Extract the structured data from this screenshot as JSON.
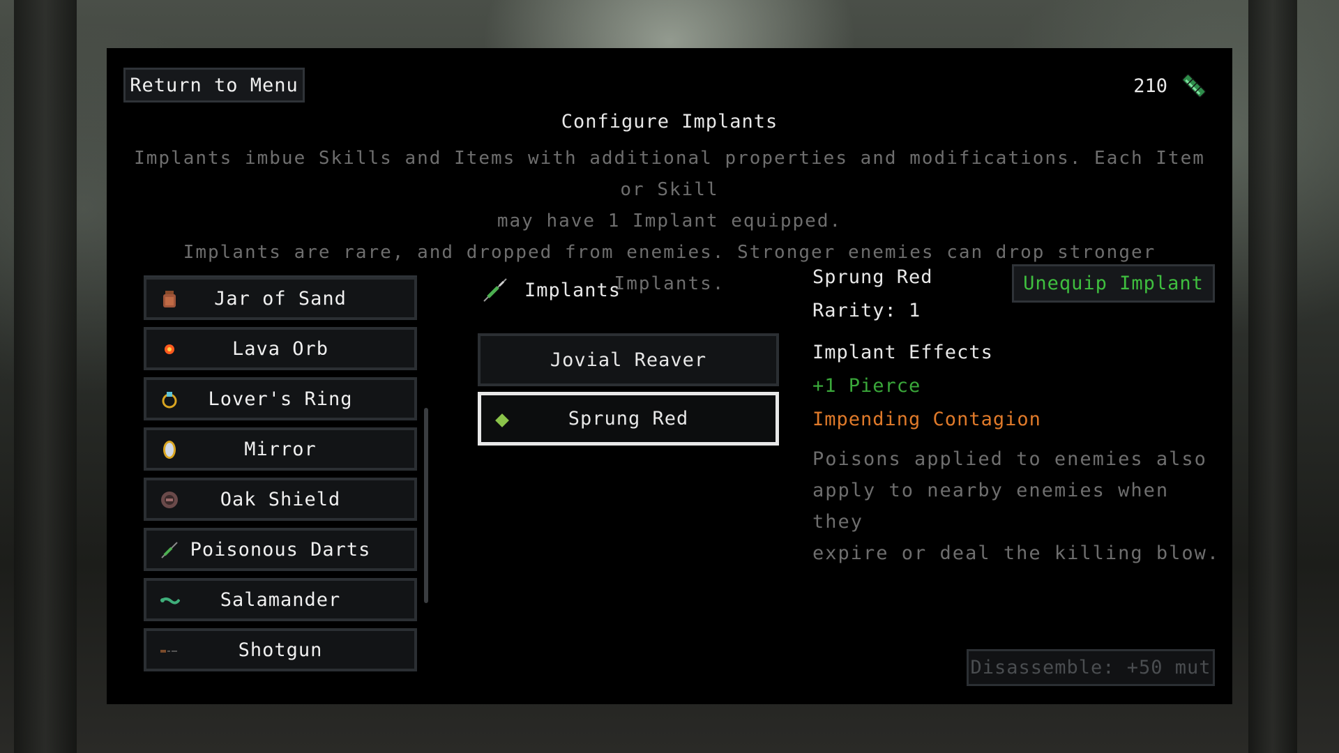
{
  "header": {
    "return_label": "Return to Menu",
    "currency_amount": "210",
    "currency_icon": "green-vial-icon",
    "title": "Configure Implants",
    "description_lines": [
      "Implants imbue Skills and Items with additional properties and modifications. Each Item or Skill",
      "may have 1 Implant equipped.",
      "Implants are rare, and dropped from enemies. Stronger enemies can drop stronger Implants."
    ]
  },
  "items": [
    {
      "label": "Jar of Sand",
      "icon": "jar-icon"
    },
    {
      "label": "Lava Orb",
      "icon": "orb-icon"
    },
    {
      "label": "Lover's Ring",
      "icon": "ring-icon"
    },
    {
      "label": "Mirror",
      "icon": "mirror-icon"
    },
    {
      "label": "Oak Shield",
      "icon": "shield-icon"
    },
    {
      "label": "Poisonous Darts",
      "icon": "dart-icon"
    },
    {
      "label": "Salamander",
      "icon": "salamander-icon"
    },
    {
      "label": "Shotgun",
      "icon": "shotgun-icon"
    }
  ],
  "implants": {
    "header_label": "Implants",
    "header_icon": "syringe-icon",
    "list": [
      {
        "label": "Jovial Reaver",
        "selected": false
      },
      {
        "label": "Sprung Red",
        "selected": true
      }
    ]
  },
  "detail": {
    "name": "Sprung Red",
    "rarity": "Rarity: 1",
    "effects_heading": "Implant Effects",
    "stat": "+1 Pierce",
    "ability_name": "Impending Contagion",
    "ability_desc_lines": [
      "Poisons applied to enemies also",
      "apply to nearby enemies when they",
      "expire or deal the killing blow."
    ],
    "unequip_label": "Unequip Implant",
    "disassemble_label": "Disassemble: +50 mut"
  },
  "colors": {
    "panel_bg": "#000000",
    "button_bg": "#121416",
    "button_border": "#2b2f33",
    "green_accent": "#3fbf3f",
    "orange_accent": "#e07a2a",
    "muted_text": "#6e6e6e"
  }
}
